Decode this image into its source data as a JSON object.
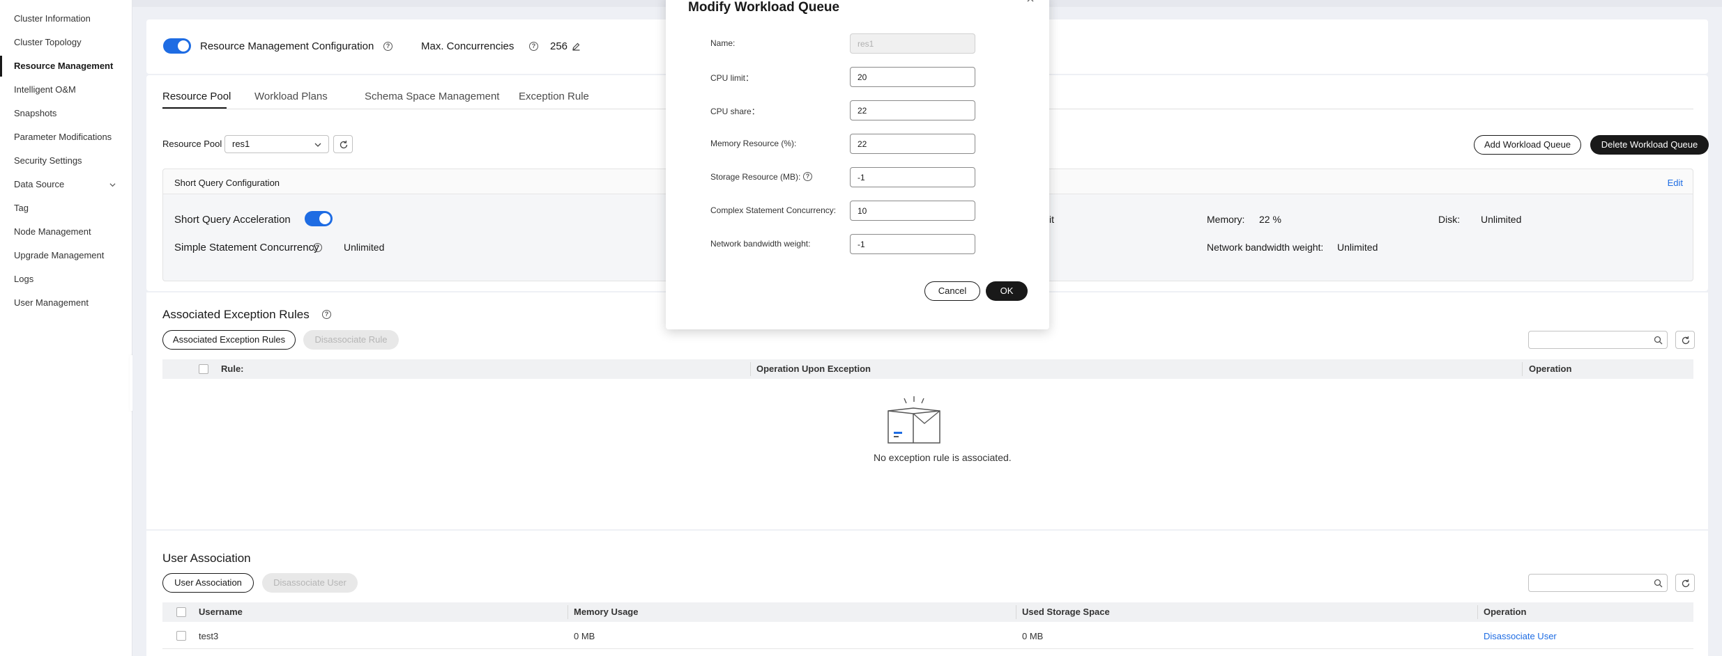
{
  "sidebar": {
    "items": [
      {
        "label": "Cluster Information"
      },
      {
        "label": "Cluster Topology"
      },
      {
        "label": "Resource Management"
      },
      {
        "label": "Intelligent O&M"
      },
      {
        "label": "Snapshots"
      },
      {
        "label": "Parameter Modifications"
      },
      {
        "label": "Security Settings"
      },
      {
        "label": "Data Source"
      },
      {
        "label": "Tag"
      },
      {
        "label": "Node Management"
      },
      {
        "label": "Upgrade Management"
      },
      {
        "label": "Logs"
      },
      {
        "label": "User Management"
      }
    ],
    "active_index": 2
  },
  "config": {
    "resource_management_label": "Resource Management Configuration",
    "resource_management_enabled": true,
    "max_concurrencies_label": "Max. Concurrencies",
    "max_concurrencies_value": "256"
  },
  "tabs": [
    {
      "label": "Resource Pool",
      "active": true
    },
    {
      "label": "Workload Plans",
      "active": false
    },
    {
      "label": "Schema Space Management",
      "active": false
    },
    {
      "label": "Exception Rule",
      "active": false
    }
  ],
  "pool": {
    "label": "Resource Pool",
    "selected": "res1",
    "add_queue_label": "Add Workload Queue",
    "delete_queue_label": "Delete Workload Queue"
  },
  "short_query": {
    "header": "Short Query Configuration",
    "edit_label": "Edit",
    "acceleration_label": "Short Query Acceleration",
    "acceleration_enabled": true,
    "simple_concurrency_label": "Simple Statement Concurrency",
    "simple_concurrency_value": "Unlimited",
    "partial_text": "it",
    "memory_label": "Memory:",
    "memory_value": "22 %",
    "disk_label": "Disk:",
    "disk_value": "Unlimited",
    "network_label": "Network bandwidth weight:",
    "network_value": "Unlimited"
  },
  "exceptions": {
    "title": "Associated Exception Rules",
    "associate_label": "Associated Exception Rules",
    "disassociate_label": "Disassociate Rule",
    "columns": [
      "Rule:",
      "Operation Upon Exception",
      "Operation"
    ],
    "empty_text": "No exception rule is associated."
  },
  "users": {
    "title": "User Association",
    "associate_label": "User Association",
    "disassociate_label": "Disassociate User",
    "columns": [
      "Username",
      "Memory Usage",
      "Used Storage Space",
      "Operation"
    ],
    "rows": [
      {
        "username": "test3",
        "memory": "0 MB",
        "storage": "0 MB",
        "operation": "Disassociate User"
      }
    ]
  },
  "modal": {
    "title": "Modify Workload Queue",
    "fields": [
      {
        "label": "Name:",
        "value": "res1",
        "disabled": true
      },
      {
        "label": "CPU limit：",
        "value": "20"
      },
      {
        "label": "CPU share：",
        "value": "22"
      },
      {
        "label": "Memory Resource (%):",
        "value": "22"
      },
      {
        "label": "Storage Resource (MB):",
        "value": "-1"
      },
      {
        "label": "Complex Statement Concurrency:",
        "value": "10"
      },
      {
        "label": "Network bandwidth weight:",
        "value": "-1"
      }
    ],
    "cancel_label": "Cancel",
    "ok_label": "OK"
  },
  "colors": {
    "accent": "#1e6ce3",
    "dark_button": "#191919",
    "link": "#1e6ce3"
  }
}
